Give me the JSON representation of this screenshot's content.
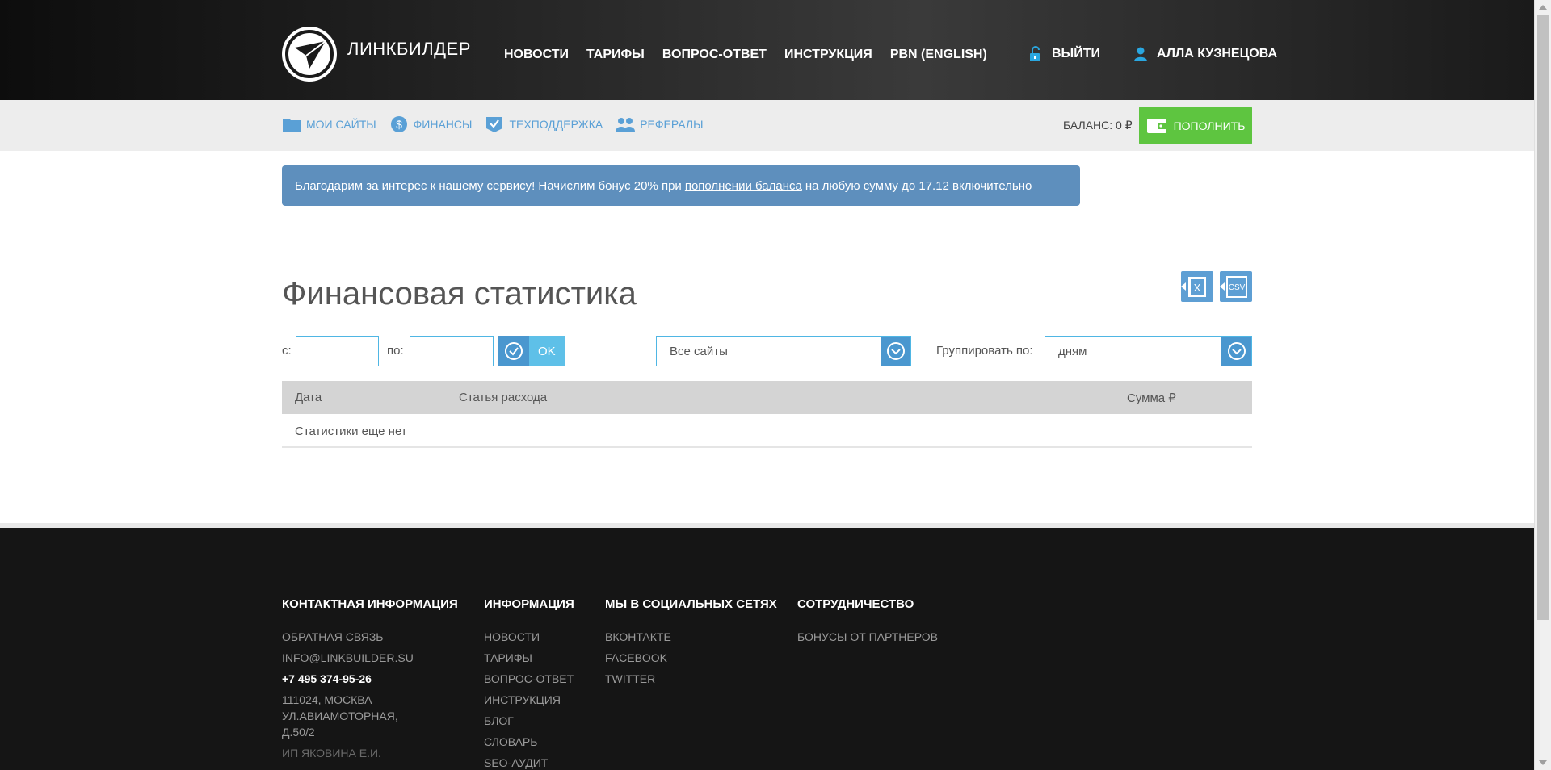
{
  "brand": {
    "name": "ЛИНКБИЛДЕР"
  },
  "main_nav": [
    {
      "label": "НОВОСТИ"
    },
    {
      "label": "ТАРИФЫ"
    },
    {
      "label": "ВОПРОС-ОТВЕТ"
    },
    {
      "label": "ИНСТРУКЦИЯ"
    },
    {
      "label": "PBN (ENGLISH)"
    }
  ],
  "user_nav": {
    "logout": "ВЫЙТИ",
    "user_name": "АЛЛА КУЗНЕЦОВА"
  },
  "sub_nav": [
    {
      "label": "МОИ САЙТЫ",
      "icon": "folder-icon"
    },
    {
      "label": "ФИНАНСЫ",
      "icon": "dollar-icon"
    },
    {
      "label": "ТЕХПОДДЕРЖКА",
      "icon": "check-badge-icon"
    },
    {
      "label": "РЕФЕРАЛЫ",
      "icon": "people-icon"
    }
  ],
  "balance": {
    "label": "БАЛАНС: 0 ₽",
    "topup_label": "ПОПОЛНИТЬ"
  },
  "alert": {
    "text_before": "Благодарим за интерес к нашему сервису! Начислим бонус 20% при",
    "link": "пополнении баланса",
    "text_after": "на любую сумму до 17.12 включительно"
  },
  "page": {
    "title": "Финансовая статистика",
    "export_xls": "X",
    "export_csv": "CSV"
  },
  "filters": {
    "from_label": "с:",
    "from_value": "",
    "to_label": "по:",
    "to_value": "",
    "ok_label": "OK",
    "site_select": "Все сайты",
    "group_label": "Группировать по:",
    "group_select": "дням"
  },
  "table": {
    "columns": [
      "Дата",
      "Статья расхода",
      "Сумма ₽"
    ],
    "empty_text": "Статистики еще нет"
  },
  "footer": {
    "contacts": {
      "heading": "КОНТАКТНАЯ ИНФОРМАЦИЯ",
      "feedback": "ОБРАТНАЯ СВЯЗЬ",
      "email": "INFO@LINKBUILDER.SU",
      "phone": "+7 495 374-95-26",
      "address_1": "111024, МОСКВА",
      "address_2": "УЛ.АВИАМОТОРНАЯ,",
      "address_3": "Д.50/2",
      "company": "ИП ЯКОВИНА Е.И."
    },
    "info": {
      "heading": "ИНФОРМАЦИЯ",
      "links": [
        "НОВОСТИ",
        "ТАРИФЫ",
        "ВОПРОС-ОТВЕТ",
        "ИНСТРУКЦИЯ",
        "БЛОГ",
        "СЛОВАРЬ",
        "SEO-АУДИТ"
      ]
    },
    "social": {
      "heading": "МЫ В СОЦИАЛЬНЫХ СЕТЯХ",
      "links": [
        "ВКОНТАКТЕ",
        "FACEBOOK",
        "TWITTER"
      ]
    },
    "partners": {
      "heading": "СОТРУДНИЧЕСТВО",
      "links": [
        "БОНУСЫ ОТ ПАРТНЕРОВ"
      ]
    }
  },
  "colors": {
    "accent_blue": "#5e9fd4",
    "green": "#5ec540",
    "alert_bg": "#5e8fbd"
  }
}
